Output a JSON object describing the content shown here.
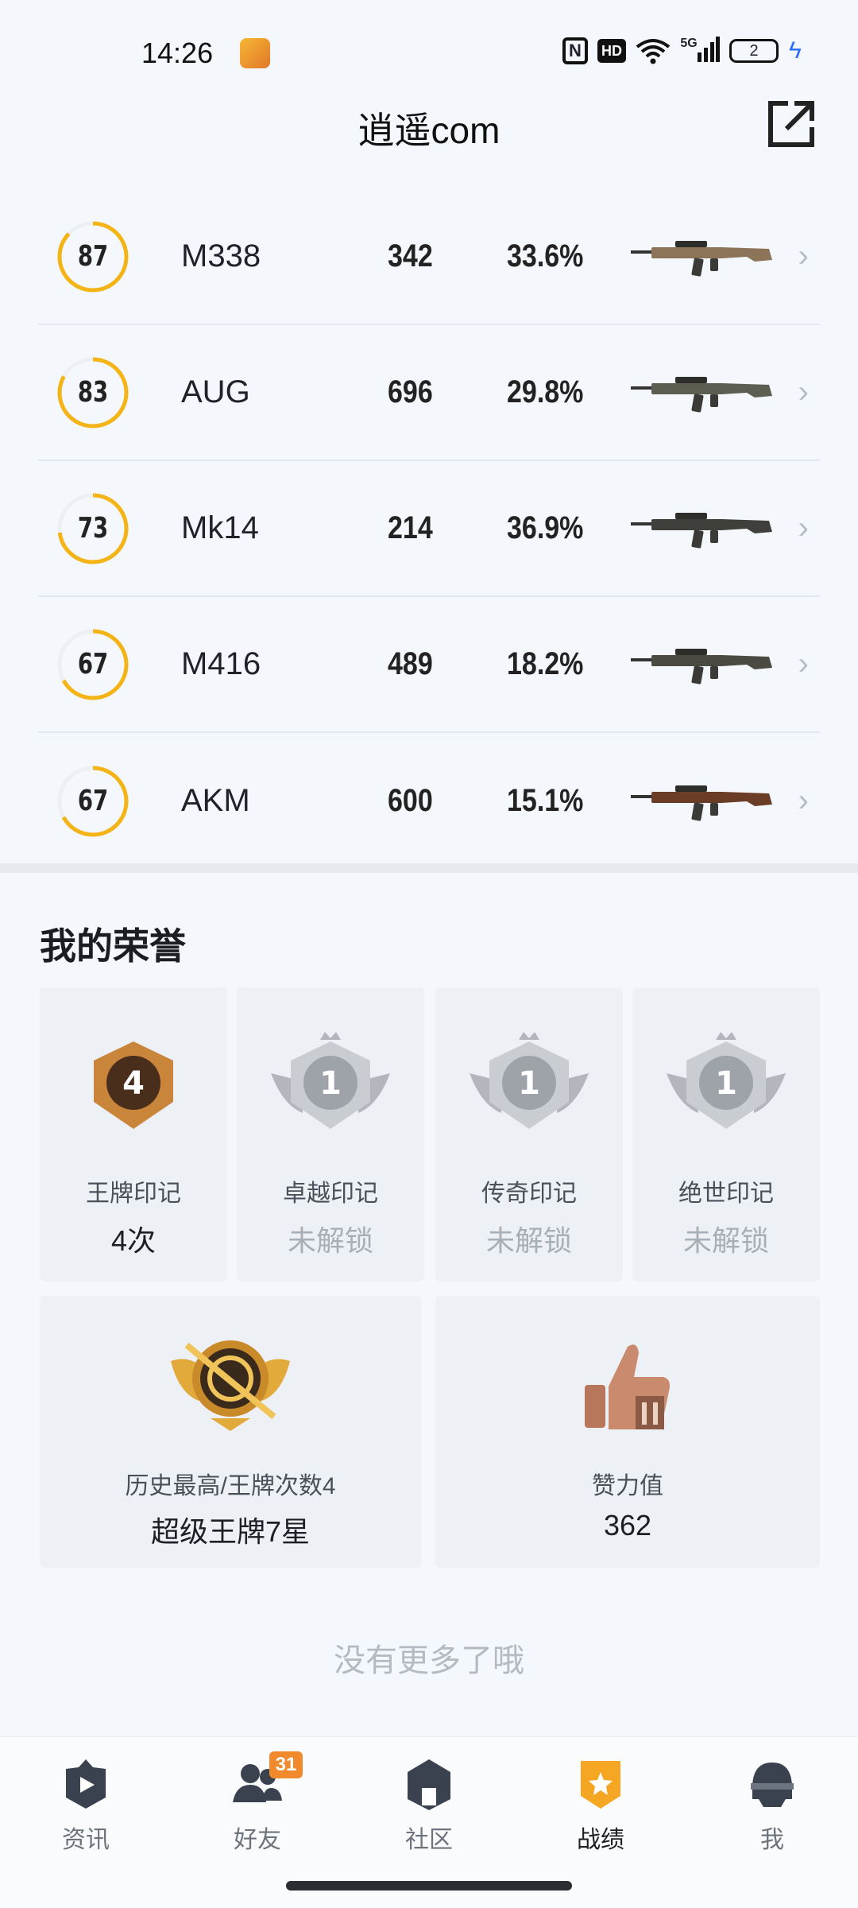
{
  "status_bar": {
    "time": "14:26",
    "battery": "2",
    "signal_label": "5G"
  },
  "header": {
    "title": "逍遥com"
  },
  "weapons": [
    {
      "rating": "87",
      "rating_pct": 0.87,
      "name": "M338",
      "kills": "342",
      "rate": "33.6%",
      "image_icon": "m338-rifle-icon"
    },
    {
      "rating": "83",
      "rating_pct": 0.83,
      "name": "AUG",
      "kills": "696",
      "rate": "29.8%",
      "image_icon": "aug-rifle-icon"
    },
    {
      "rating": "73",
      "rating_pct": 0.73,
      "name": "Mk14",
      "kills": "214",
      "rate": "36.9%",
      "image_icon": "mk14-rifle-icon"
    },
    {
      "rating": "67",
      "rating_pct": 0.67,
      "name": "M416",
      "kills": "489",
      "rate": "18.2%",
      "image_icon": "m416-rifle-icon"
    },
    {
      "rating": "67",
      "rating_pct": 0.67,
      "name": "AKM",
      "kills": "600",
      "rate": "15.1%",
      "image_icon": "akm-rifle-icon"
    }
  ],
  "honor": {
    "title": "我的荣誉",
    "marks": [
      {
        "badge_number": "4",
        "label": "王牌印记",
        "value": "4次",
        "locked": false
      },
      {
        "badge_number": "1",
        "label": "卓越印记",
        "value": "未解锁",
        "locked": true
      },
      {
        "badge_number": "1",
        "label": "传奇印记",
        "value": "未解锁",
        "locked": true
      },
      {
        "badge_number": "1",
        "label": "绝世印记",
        "value": "未解锁",
        "locked": true
      }
    ],
    "highest": {
      "label": "历史最高/王牌次数4",
      "value": "超级王牌7星"
    },
    "likes": {
      "label": "赞力值",
      "value": "362"
    }
  },
  "end_text": "没有更多了哦",
  "nav": [
    {
      "label": "资讯",
      "icon": "news-icon",
      "active": false
    },
    {
      "label": "好友",
      "icon": "friends-icon",
      "active": false,
      "badge": "31"
    },
    {
      "label": "社区",
      "icon": "community-icon",
      "active": false
    },
    {
      "label": "战绩",
      "icon": "record-icon",
      "active": true
    },
    {
      "label": "我",
      "icon": "profile-icon",
      "active": false
    }
  ],
  "colors": {
    "accent": "#f5b416",
    "ring_track": "#eceff3",
    "badge": "#f08a2c"
  }
}
